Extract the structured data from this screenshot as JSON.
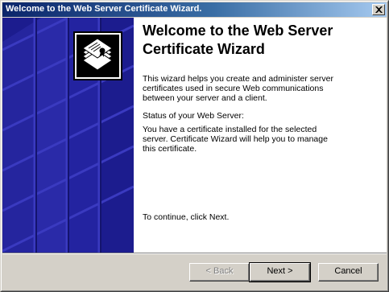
{
  "window": {
    "title": "Welcome to the Web Server Certificate Wizard."
  },
  "content": {
    "heading": "Welcome to the Web Server Certificate Wizard",
    "intro": "This wizard helps you create and administer server certificates used in secure Web communications between your server and a client.",
    "status_label": "Status of your Web Server:",
    "status_text": "You have a certificate installed for the selected server. Certificate Wizard will help you to manage this certificate.",
    "continue_text": "To continue, click Next."
  },
  "buttons": {
    "back": "< Back",
    "next": "Next >",
    "cancel": "Cancel"
  },
  "icons": {
    "close": "close-icon",
    "certificate": "certificate-stack-icon"
  },
  "colors": {
    "banner": "#1c1c8e",
    "titlebar_start": "#0a246a",
    "titlebar_end": "#a6caf0",
    "dialog_face": "#d4d0c8"
  }
}
